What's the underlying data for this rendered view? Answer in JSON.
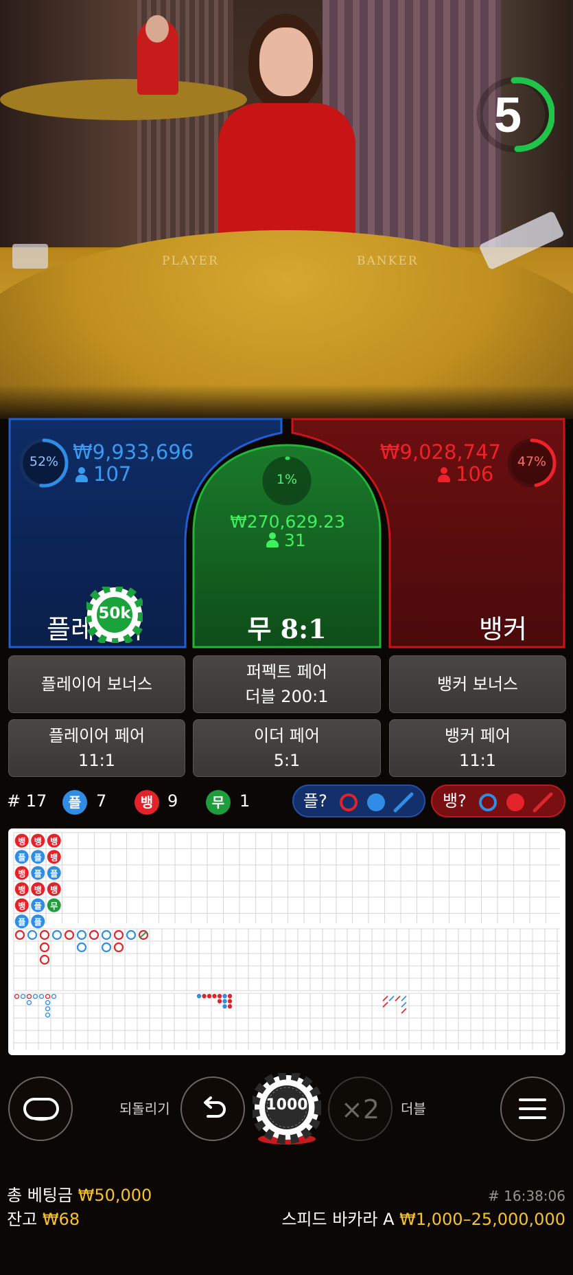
{
  "timer": {
    "count": "5"
  },
  "table": {
    "player_text": "PLAYER",
    "banker_text": "BANKER"
  },
  "player": {
    "percent": "52%",
    "amount": "₩9,933,696",
    "count": "107",
    "label": "플레이어",
    "chip": "50k"
  },
  "tie": {
    "percent": "1%",
    "amount": "₩270,629.23",
    "count": "31",
    "label": "무 8:1"
  },
  "banker": {
    "percent": "47%",
    "amount": "₩9,028,747",
    "count": "106",
    "label": "뱅커"
  },
  "side_bets": [
    {
      "line1": "플레이어 보너스",
      "line2": ""
    },
    {
      "line1": "퍼펙트 페어",
      "line2": "더블 200:1"
    },
    {
      "line1": "뱅커 보너스",
      "line2": ""
    },
    {
      "line1": "플레이어 페어",
      "line2": "11:1"
    },
    {
      "line1": "이더 페어",
      "line2": "5:1"
    },
    {
      "line1": "뱅커 페어",
      "line2": "11:1"
    }
  ],
  "stats": {
    "round": "# 17",
    "player_icon": "플",
    "player_count": "7",
    "banker_icon": "뱅",
    "banker_count": "9",
    "tie_icon": "무",
    "tie_count": "1",
    "player_predict": "플?",
    "banker_predict": "뱅?"
  },
  "bead_road": [
    [
      "뱅",
      "플",
      "뱅",
      "뱅",
      "뱅",
      "플"
    ],
    [
      "뱅",
      "플",
      "플",
      "뱅",
      "플",
      "플"
    ],
    [
      "뱅",
      "뱅",
      "플",
      "뱅",
      "무",
      ""
    ]
  ],
  "controls": {
    "undo_label": "되돌리기",
    "chip_value": "1000",
    "double_symbol": "×2",
    "double_label": "더블"
  },
  "footer": {
    "total_bet_label": "총 베팅금",
    "total_bet_value": "₩50,000",
    "balance_label": "잔고",
    "balance_value": "₩68",
    "game_id": "# 16:38:06",
    "table_name": "스피드 바카라 A",
    "limits": "₩1,000–25,000,000"
  },
  "colors": {
    "player": "#2f8de6",
    "banker": "#e3232a",
    "tie": "#1f9c3c",
    "gold": "#f7c326"
  },
  "icons": [
    "person-icon",
    "circle-outline-icon",
    "circle-filled-icon",
    "slash-icon",
    "undo-icon",
    "chip-icon",
    "menu-icon",
    "stadium-icon"
  ]
}
